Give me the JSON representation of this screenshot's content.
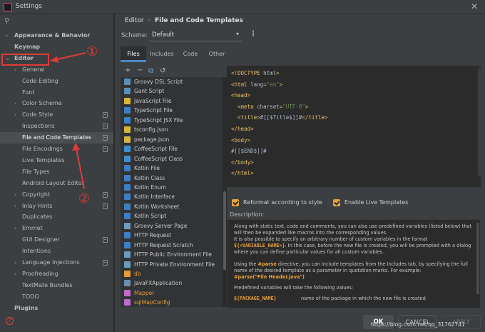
{
  "window": {
    "title": "Settings",
    "close": "✕"
  },
  "search": {
    "icon": "search-icon",
    "symbol": "⚲"
  },
  "sidebar": {
    "items": [
      {
        "label": "Appearance & Behavior",
        "bold": true,
        "arrow": "›"
      },
      {
        "label": "Keymap",
        "bold": true,
        "arrow": ""
      },
      {
        "label": "Editor",
        "bold": true,
        "arrow": "⌄"
      },
      {
        "label": "General",
        "arrow": "›"
      },
      {
        "label": "Code Editing",
        "arrow": ""
      },
      {
        "label": "Font",
        "arrow": ""
      },
      {
        "label": "Color Scheme",
        "arrow": "›"
      },
      {
        "label": "Code Style",
        "arrow": "›",
        "icon": true
      },
      {
        "label": "Inspections",
        "arrow": "",
        "icon": true
      },
      {
        "label": "File and Code Templates",
        "arrow": "",
        "icon": true,
        "selected": true
      },
      {
        "label": "File Encodings",
        "arrow": "",
        "icon": true
      },
      {
        "label": "Live Templates",
        "arrow": ""
      },
      {
        "label": "File Types",
        "arrow": ""
      },
      {
        "label": "Android Layout Editor",
        "arrow": ""
      },
      {
        "label": "Copyright",
        "arrow": "›",
        "icon": true
      },
      {
        "label": "Inlay Hints",
        "arrow": "›",
        "icon": true
      },
      {
        "label": "Duplicates",
        "arrow": ""
      },
      {
        "label": "Emmet",
        "arrow": "›"
      },
      {
        "label": "GUI Designer",
        "arrow": "",
        "icon": true
      },
      {
        "label": "Intentions",
        "arrow": ""
      },
      {
        "label": "Language Injections",
        "arrow": "›",
        "icon": true
      },
      {
        "label": "Proofreading",
        "arrow": "›"
      },
      {
        "label": "TextMate Bundles",
        "arrow": ""
      },
      {
        "label": "TODO",
        "arrow": ""
      },
      {
        "label": "Plugins",
        "bold": true,
        "arrow": ""
      }
    ]
  },
  "annotations": {
    "one": "①",
    "two": "②"
  },
  "breadcrumb": {
    "parent": "Editor",
    "sep": "›",
    "current": "File and Code Templates"
  },
  "scheme": {
    "label": "Scheme:",
    "value": "Default",
    "dropdown": "▾",
    "menu": "⋮"
  },
  "tabs": [
    "Files",
    "Includes",
    "Code",
    "Other"
  ],
  "toolbar": {
    "add": "+",
    "remove": "−",
    "copy": "⧉",
    "reset": "↺"
  },
  "files": [
    {
      "name": "Groovy DSL Script",
      "color": "#5a8fb8"
    },
    {
      "name": "Gant Script",
      "color": "#5a8fb8"
    },
    {
      "name": "JavaScript File",
      "color": "#d6b73c"
    },
    {
      "name": "TypeScript File",
      "color": "#3c7fc6"
    },
    {
      "name": "TypeScript JSX File",
      "color": "#3c7fc6"
    },
    {
      "name": "tsconfig.json",
      "color": "#d6b73c"
    },
    {
      "name": "package.json",
      "color": "#d6b73c"
    },
    {
      "name": "CoffeeScript File",
      "color": "#3c8fd6"
    },
    {
      "name": "CoffeeScript Class",
      "color": "#3c8fd6"
    },
    {
      "name": "Kotlin File",
      "color": "#3c7fc6"
    },
    {
      "name": "Kotlin Class",
      "color": "#3c7fc6"
    },
    {
      "name": "Kotlin Enum",
      "color": "#3c7fc6"
    },
    {
      "name": "Kotlin Interface",
      "color": "#3c7fc6"
    },
    {
      "name": "Kotlin Worksheet",
      "color": "#3c7fc6"
    },
    {
      "name": "Kotlin Script",
      "color": "#3c7fc6"
    },
    {
      "name": "Groovy Server Page",
      "color": "#6a9bc0"
    },
    {
      "name": "HTTP Request",
      "color": "#3c7fc6"
    },
    {
      "name": "HTTP Request Scratch",
      "color": "#3c7fc6"
    },
    {
      "name": "HTTP Public Environment File",
      "color": "#6a9bc0"
    },
    {
      "name": "HTTP Private Environment File",
      "color": "#6a9bc0"
    },
    {
      "name": "db",
      "color": "#e89a36",
      "orange": true
    },
    {
      "name": "JavaFXApplication",
      "color": "#6a8fb0"
    },
    {
      "name": "Mapper",
      "color": "#c06acb",
      "orange": true
    },
    {
      "name": "sqlMapConfig",
      "color": "#c06acb",
      "orange": true
    }
  ],
  "code_lines": [
    [
      {
        "t": "<!DOCTYPE ",
        "c": "tag"
      },
      {
        "t": "html",
        "c": "attr"
      },
      {
        "t": ">",
        "c": "tag"
      }
    ],
    [
      {
        "t": "<html ",
        "c": "tag"
      },
      {
        "t": "lang=",
        "c": "attr"
      },
      {
        "t": "\"en\"",
        "c": "str"
      },
      {
        "t": ">",
        "c": "tag"
      }
    ],
    [
      {
        "t": "<head>",
        "c": "tag"
      }
    ],
    [
      {
        "t": "  <meta ",
        "c": "tag"
      },
      {
        "t": "charset=",
        "c": "attr"
      },
      {
        "t": "\"UTF-8\"",
        "c": "str"
      },
      {
        "t": ">",
        "c": "tag"
      }
    ],
    [
      {
        "t": "  <title>",
        "c": "tag"
      },
      {
        "t": "#[[$Title$]]#",
        "c": "plain"
      },
      {
        "t": "</title>",
        "c": "tag"
      }
    ],
    [
      {
        "t": "</head>",
        "c": "tag"
      }
    ],
    [
      {
        "t": "<body>",
        "c": "tag"
      }
    ],
    [
      {
        "t": "#[[$END$]]#",
        "c": "plain"
      }
    ],
    [
      {
        "t": "</body>",
        "c": "tag"
      }
    ],
    [
      {
        "t": "</html>",
        "c": "tag"
      }
    ]
  ],
  "options": {
    "reformat": "Reformat according to style",
    "live": "Enable Live Templates"
  },
  "description": {
    "label": "Description:",
    "p1": "Along with static text, code and comments, you can also use predefined variables (listed below) that will then be expanded like macros into the corresponding values.",
    "p2a": "It is also possible to specify an arbitrary number of custom variables in the format ",
    "p2var": "${<VARIABLE_NAME>}",
    "p2b": ". In this case, before the new file is created, you will be prompted with a dialog where you can define particular values for all custom variables.",
    "p3a": "Using the ",
    "p3kw": "#parse",
    "p3b": " directive, you can include templates from the Includes tab, by specifying the full name of the desired template as a parameter in quotation marks. For example:",
    "example": "#parse(\"File Header.java\")",
    "p4": "Predefined variables will take the following values:",
    "varname": "${PACKAGE_NAME}",
    "vardesc": "name of the package in which the new file is created"
  },
  "buttons": {
    "ok": "OK",
    "cancel": "CANCEL",
    "apply": "APPLY"
  },
  "help": "?",
  "watermark": "https://blog.csdn.net/qq_31762741"
}
